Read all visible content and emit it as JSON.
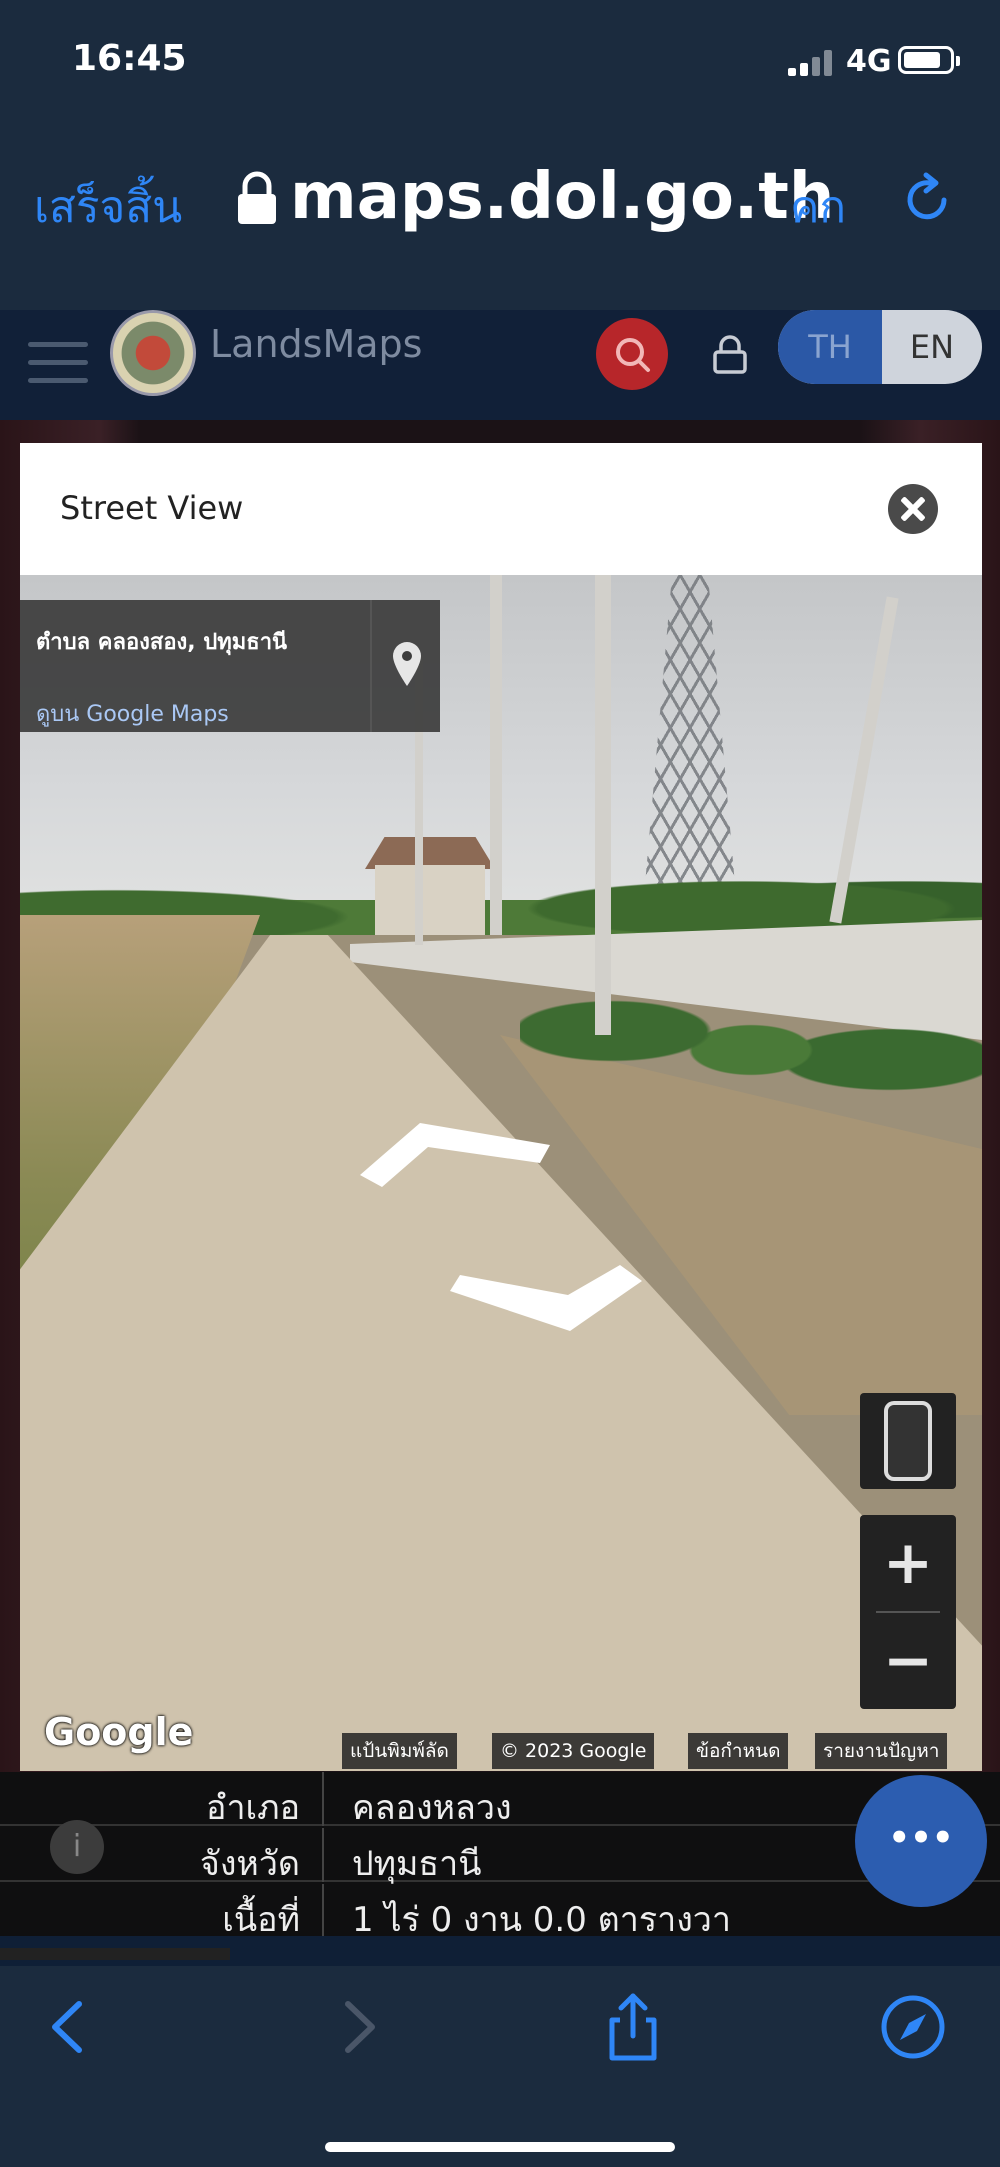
{
  "status_bar": {
    "time": "16:45",
    "network": "4G"
  },
  "browser": {
    "done_label": "เสร็จสิ้น",
    "url": "maps.dol.go.th",
    "text_size_label": "คก"
  },
  "app": {
    "name": "LandsMaps",
    "lang_th": "TH",
    "lang_en": "EN"
  },
  "modal": {
    "title": "Street View"
  },
  "street_view": {
    "location_name": "ตำบล คลองสอง, ปทุมธานี",
    "google_maps_link": "ดูบน Google Maps",
    "google_logo": "Google",
    "attribution": [
      "แป้นพิมพ์ลัด",
      "© 2023 Google",
      "ข้อกำหนด",
      "รายงานปัญหา"
    ],
    "zoom_in": "+",
    "zoom_out": "−"
  },
  "info": {
    "rows": [
      {
        "label": "อำเภอ",
        "value": "คลองหลวง"
      },
      {
        "label": "จังหวัด",
        "value": "ปทุมธานี"
      },
      {
        "label": "เนื้อที่",
        "value": "1 ไร่ 0 งาน 0.0 ตารางวา"
      }
    ],
    "fab_label": "•••"
  }
}
